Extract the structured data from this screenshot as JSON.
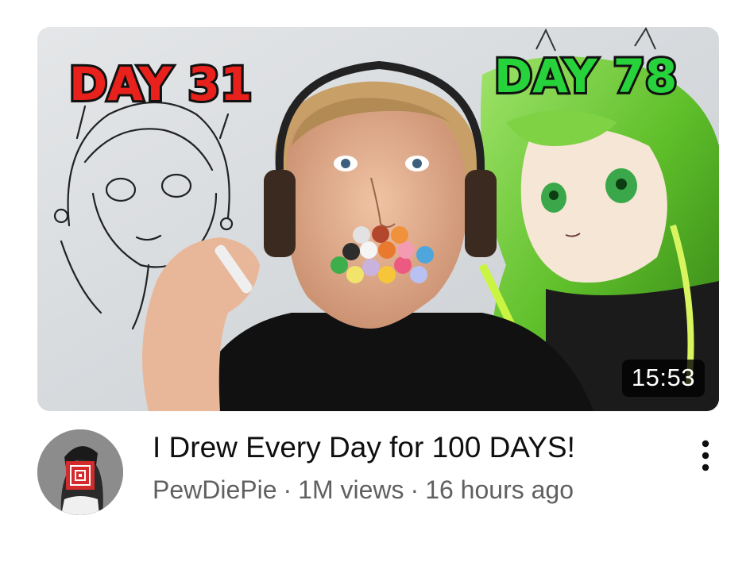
{
  "video": {
    "title": "I Drew Every Day for 100 DAYS!",
    "duration": "15:53",
    "thumbnail": {
      "left_label": "DAY 31",
      "right_label": "DAY 78",
      "left_label_color": "#e8211c",
      "right_label_color": "#27d33a"
    }
  },
  "channel": {
    "name": "PewDiePie",
    "views": "1M views",
    "uploaded": "16 hours ago",
    "separator": "·"
  },
  "icons": {
    "more": "more-vertical-icon",
    "avatar": "channel-avatar"
  },
  "colors": {
    "title": "#0f0f0f",
    "meta": "#606060",
    "badge_bg": "#000000"
  }
}
